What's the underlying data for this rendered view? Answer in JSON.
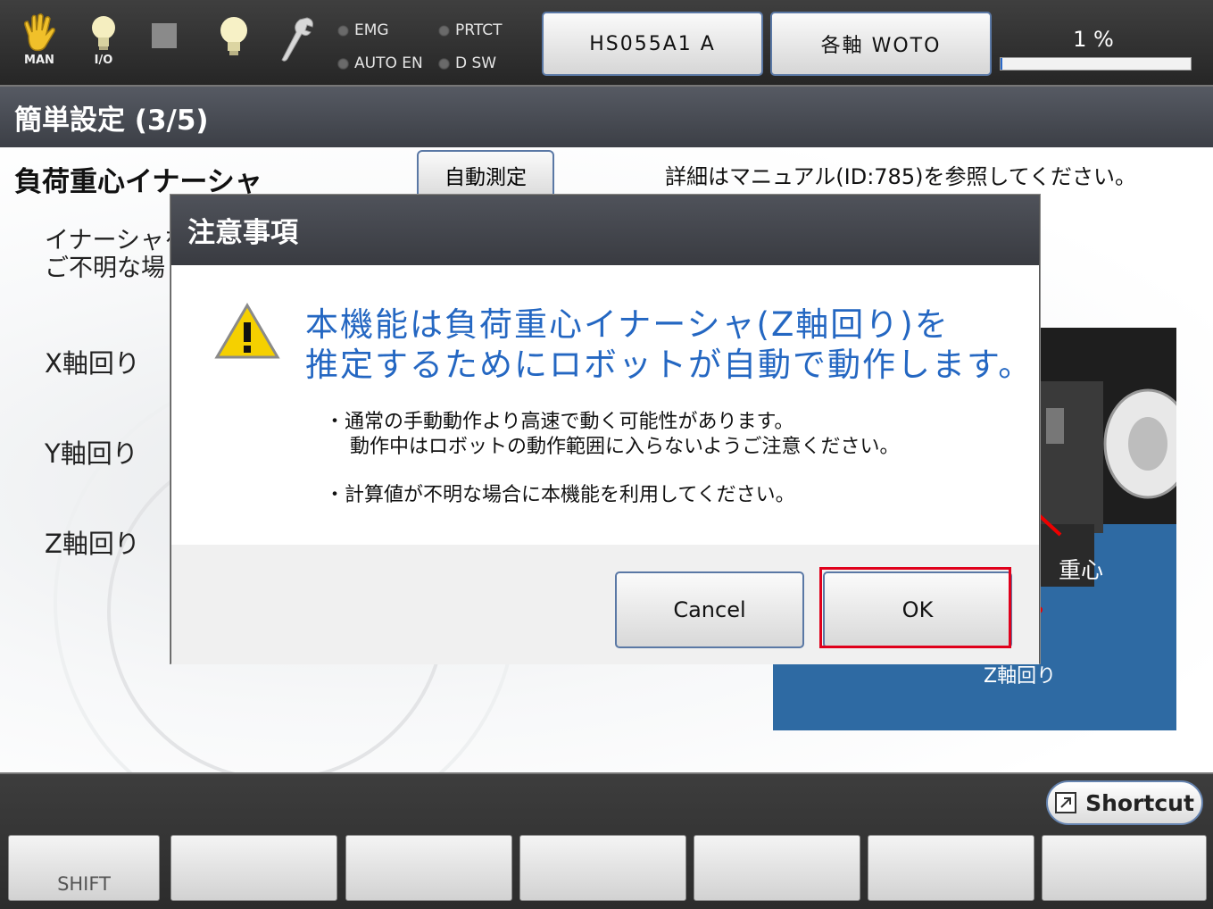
{
  "status_bar": {
    "icons": [
      {
        "name": "hand-icon",
        "caption": "MAN"
      },
      {
        "name": "io-bulb-icon",
        "caption": "I/O"
      },
      {
        "name": "stop-square-icon",
        "caption": ""
      },
      {
        "name": "lightbulb-icon",
        "caption": ""
      },
      {
        "name": "wrench-icon",
        "caption": ""
      }
    ],
    "indicators": [
      "EMG",
      "PRTCT",
      "AUTO EN",
      "D SW"
    ],
    "robot_button": "HS055A1 A",
    "axis_button": "各軸 WOTO",
    "speed_percent": "1 %",
    "speed_value": 1
  },
  "title": "簡単設定 (3/5)",
  "section": {
    "title": "負荷重心イナーシャ",
    "auto_measure_button": "自動測定",
    "manual_note": "詳細はマニュアル(ID:785)を参照してください。",
    "desc_line1": "イナーシャを",
    "desc_line2": "ご不明な場",
    "axes": [
      "X軸回り",
      "Y軸回り",
      "Z軸回り"
    ]
  },
  "illustration": {
    "center_label": "重心",
    "axis_label": "Z軸回り"
  },
  "dialog": {
    "title": "注意事項",
    "message_line1": "本機能は負荷重心イナーシャ(Z軸回り)を",
    "message_line2": "推定するためにロボットが自動で動作します。",
    "note1_line1": "・通常の手動動作より高速で動く可能性があります。",
    "note1_line2": "動作中はロボットの動作範囲に入らないようご注意ください。",
    "note2": "・計算値が不明な場合に本機能を利用してください。",
    "cancel_label": "Cancel",
    "ok_label": "OK"
  },
  "bottom": {
    "shortcut_label": "Shortcut",
    "function_keys": [
      "SHIFT",
      "",
      "",
      "",
      "",
      "",
      ""
    ]
  },
  "colors": {
    "message_blue": "#2467c2",
    "highlight_red": "#e0001b",
    "illustration_blue": "#2e6aa3"
  }
}
